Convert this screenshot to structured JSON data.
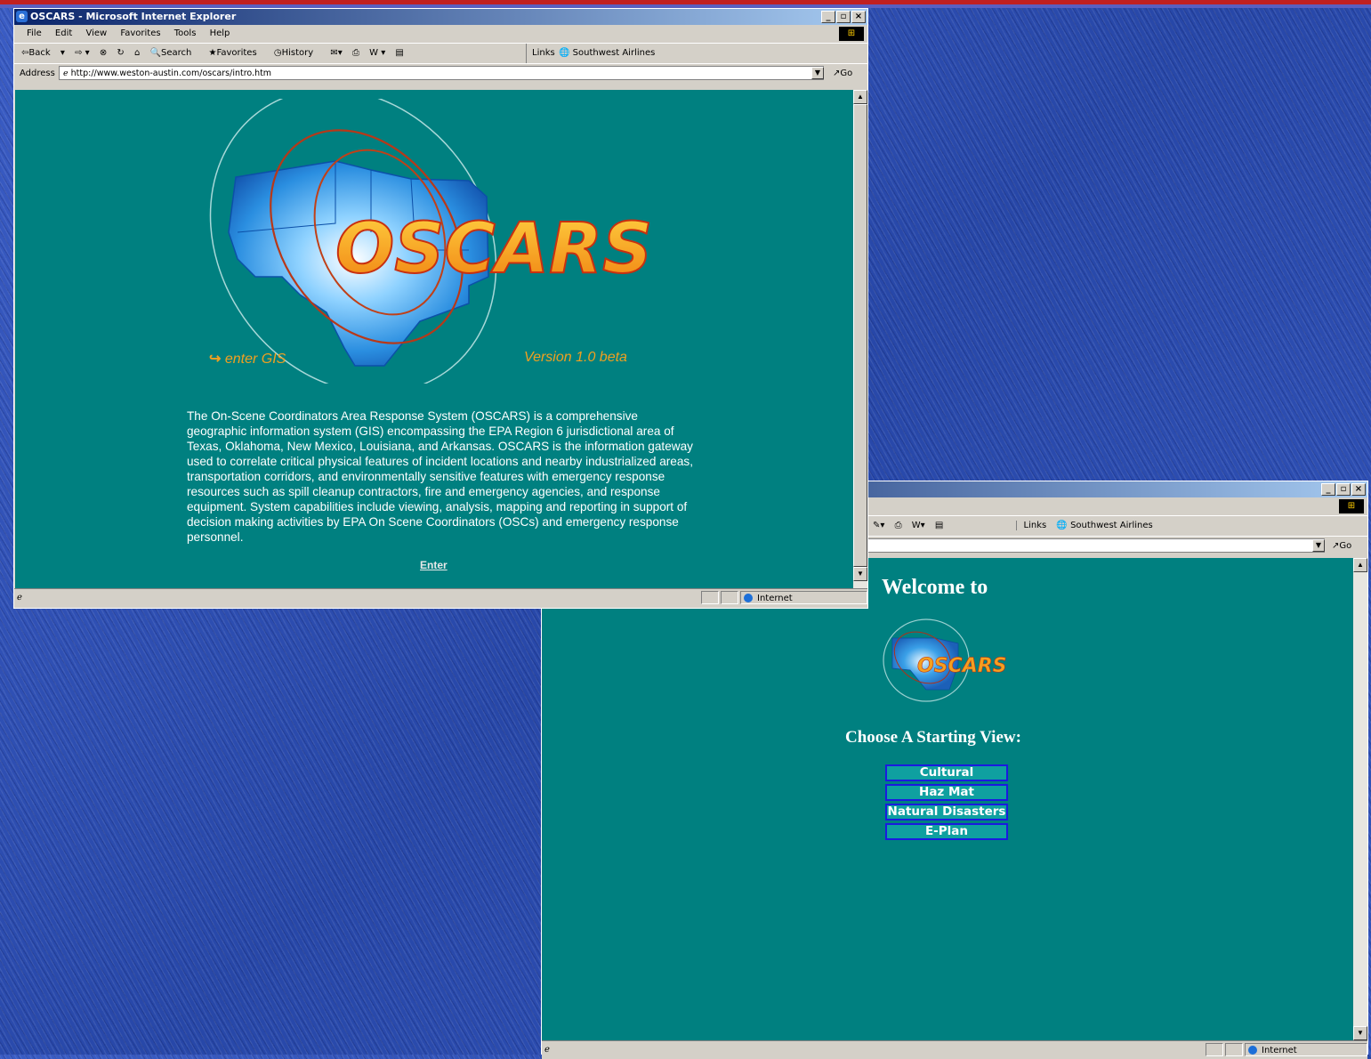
{
  "window1": {
    "title": "OSCARS - Microsoft Internet Explorer",
    "menu": [
      "File",
      "Edit",
      "View",
      "Favorites",
      "Tools",
      "Help"
    ],
    "toolbar": {
      "back": "Back",
      "search": "Search",
      "favorites": "Favorites",
      "history": "History",
      "links": "Links",
      "southwest": "Southwest Airlines"
    },
    "address_label": "Address",
    "address_value": "http://www.weston-austin.com/oscars/intro.htm",
    "go_label": "Go",
    "logo_text": "OSCARS",
    "enter_gis": "enter GIS",
    "version": "Version 1.0 beta",
    "description": "The On-Scene Coordinators Area Response System (OSCARS) is a comprehensive geographic information system (GIS) encompassing the EPA Region 6 jurisdictional area of Texas, Oklahoma, New Mexico, Louisiana, and Arkansas. OSCARS is the information gateway used to correlate critical physical features of incident locations and nearby industrialized areas, transportation corridors, and environmentally sensitive features with emergency response resources such as spill cleanup contractors, fire and emergency agencies, and response equipment. System capabilities include viewing, analysis, mapping and reporting in support of decision making activities by EPA On Scene Coordinators (OSCs) and emergency response personnel.",
    "enter_link": "Enter",
    "status_zone": "Internet"
  },
  "window2": {
    "toolbar": {
      "links": "Links",
      "southwest": "Southwest Airlines"
    },
    "go_label": "Go",
    "welcome": "Welcome to",
    "logo_text": "OSCARS",
    "choose": "Choose A Starting View:",
    "views": [
      "Cultural",
      "Haz Mat",
      "Natural Disasters",
      "E-Plan"
    ],
    "status_zone": "Internet"
  },
  "colors": {
    "teal_bg": "#008080",
    "title_bar": "#0a246a",
    "logo_orange": "#f0a020",
    "button_border": "#1a1ae0"
  }
}
